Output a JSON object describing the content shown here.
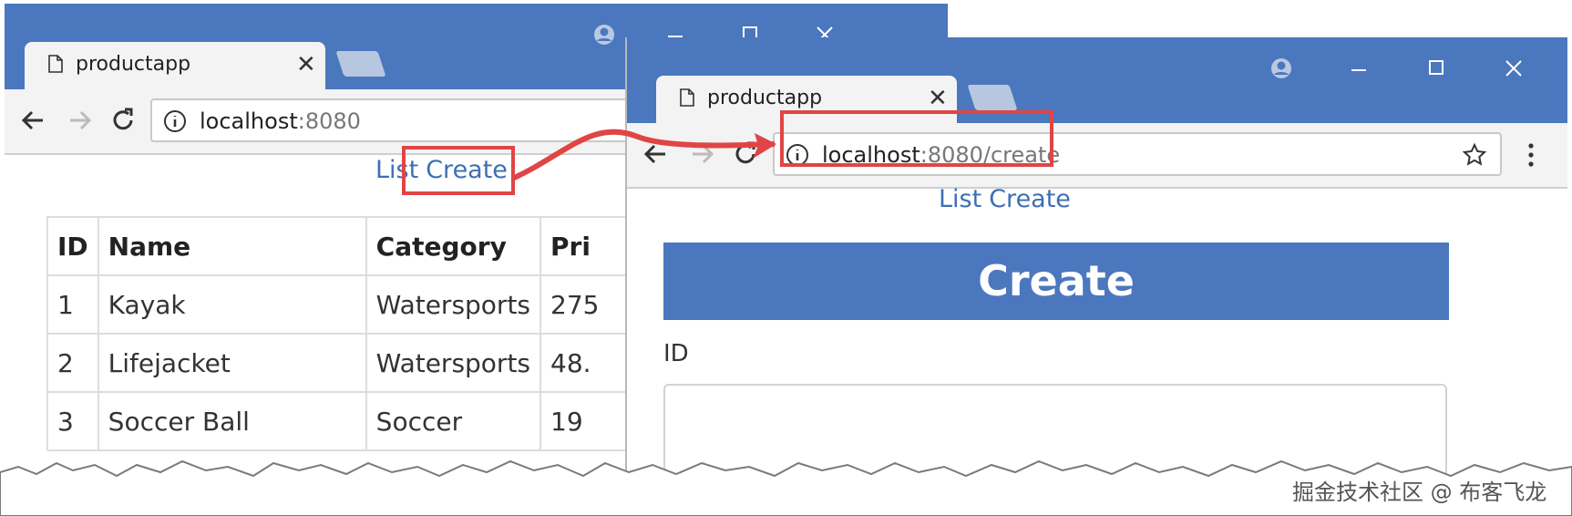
{
  "left_window": {
    "tab_title": "productapp",
    "tab_close": "✕",
    "url_host": "localhost",
    "url_rest": ":8080",
    "nav_links": [
      "List",
      "Create"
    ],
    "table": {
      "columns": [
        "ID",
        "Name",
        "Category",
        "Pri"
      ],
      "rows": [
        [
          "1",
          "Kayak",
          "Watersports",
          "275"
        ],
        [
          "2",
          "Lifejacket",
          "Watersports",
          "48."
        ],
        [
          "3",
          "Soccer Ball",
          "Soccer",
          "19"
        ]
      ]
    }
  },
  "right_window": {
    "tab_title": "productapp",
    "tab_close": "✕",
    "url_host": "localhost",
    "url_rest": ":8080/create",
    "nav_links": [
      "List",
      "Create"
    ],
    "banner_title": "Create",
    "form": {
      "id_label": "ID",
      "id_value": ""
    }
  },
  "watermark": "掘金技术社区 @ 布客飞龙",
  "colors": {
    "chrome_blue": "#4b77be",
    "link_blue": "#3d6fb5",
    "highlight_red": "#e04545"
  },
  "icons": [
    "page-icon",
    "close-icon",
    "back-arrow-icon",
    "forward-arrow-icon",
    "reload-icon",
    "info-icon",
    "star-icon",
    "kebab-menu-icon",
    "profile-icon",
    "minimize-icon",
    "maximize-icon",
    "window-close-icon"
  ]
}
